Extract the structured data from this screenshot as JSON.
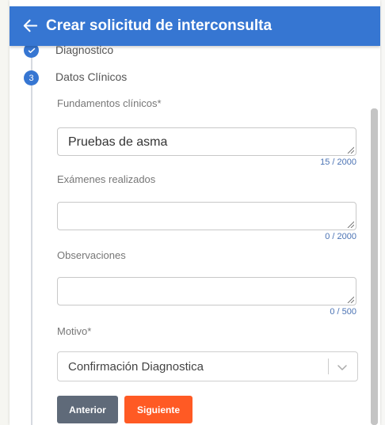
{
  "header": {
    "title": "Crear solicitud de interconsulta",
    "back_icon": "arrow-left-icon",
    "color": "#3676d2"
  },
  "steps": {
    "previous": {
      "label": "Diagnostico",
      "icon": "check-icon"
    },
    "current": {
      "number": "3",
      "label": "Datos Clínicos"
    }
  },
  "form": {
    "fundamentos": {
      "label": "Fundamentos clínicos*",
      "value": "Pruebas de asma",
      "counter": "15 / 2000"
    },
    "examenes": {
      "label": "Exámenes realizados",
      "value": "",
      "counter": "0 / 2000"
    },
    "observaciones": {
      "label": "Observaciones",
      "value": "",
      "counter": "0 / 500"
    },
    "motivo": {
      "label": "Motivo*",
      "value": "Confirmación Diagnostica"
    }
  },
  "buttons": {
    "previous": "Anterior",
    "next": "Siguiente"
  },
  "colors": {
    "primary": "#3676d2",
    "secondary_button": "#5f6a79",
    "accent_button": "#ff5a24"
  }
}
